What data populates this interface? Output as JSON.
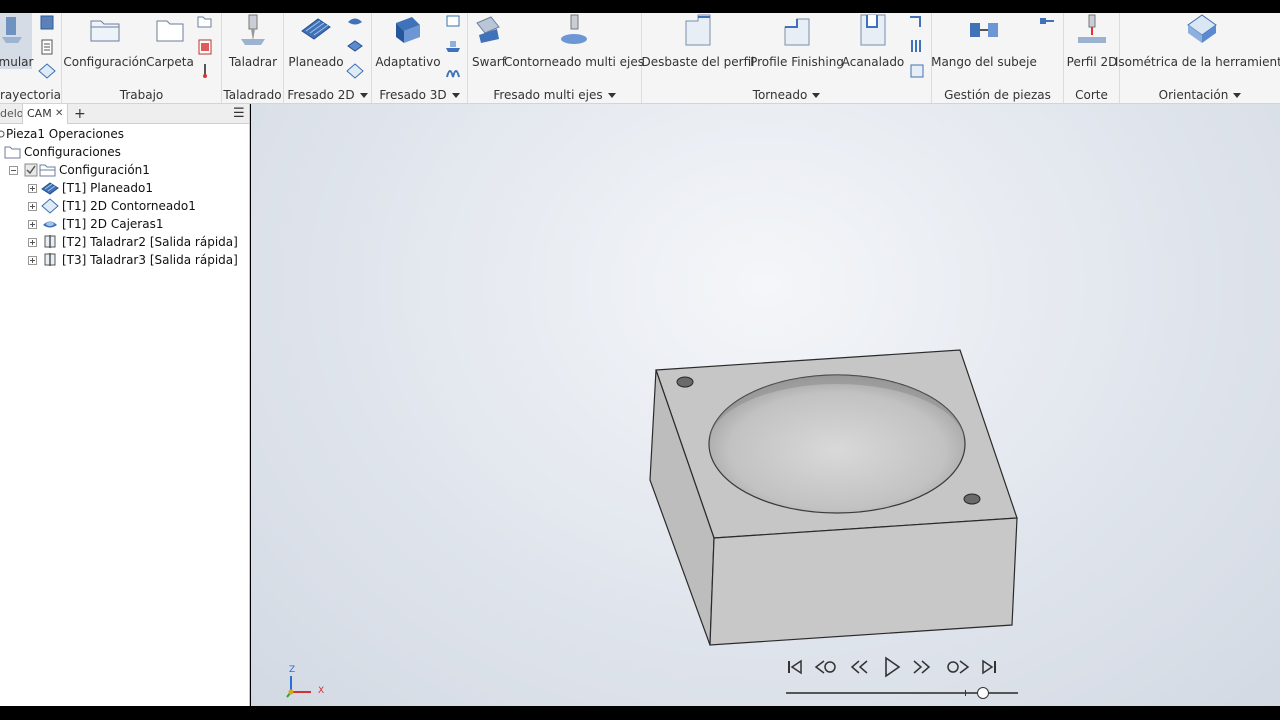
{
  "ribbon": {
    "simulate": {
      "label": "mular",
      "group": "rayectoria"
    },
    "trabajo": {
      "group": "Trabajo",
      "config_label": "Configuración",
      "folder_label": "Carpeta"
    },
    "taladrado": {
      "group": "Taladrado",
      "drill_label": "Taladrar"
    },
    "fresado2d": {
      "group": "Fresado 2D",
      "face_label": "Planeado"
    },
    "fresado3d": {
      "group": "Fresado 3D",
      "adaptive_label": "Adaptativo"
    },
    "multiejes": {
      "group": "Fresado multi ejes",
      "swarf_label": "Swarf",
      "contour_label": "Contorneado multi ejes"
    },
    "torneado": {
      "group": "Torneado",
      "rough_label": "Desbaste del perfil",
      "finish_label": "Profile Finishing",
      "groove_label": "Acanalado"
    },
    "piezas": {
      "group": "Gestión de piezas",
      "sub_label": "Mango del subeje"
    },
    "corte": {
      "group": "Corte",
      "profile_label": "Perfil 2D"
    },
    "orientacion": {
      "group": "Orientación",
      "iso_label": "Isométrica de la herramienta"
    }
  },
  "panel": {
    "tabs": {
      "model": "delo",
      "cam": "CAM",
      "close": "✕",
      "add": "+",
      "menu": "☰"
    },
    "tree": {
      "root": "Pieza1 Operaciones",
      "setups": "Configuraciones",
      "setup1": "Configuración1",
      "ops": [
        {
          "label": "[T1] Planeado1"
        },
        {
          "label": "[T1] 2D Contorneado1"
        },
        {
          "label": "[T1] 2D Cajeras1"
        },
        {
          "label": "[T2] Taladrar2 [Salida rápida]"
        },
        {
          "label": "[T3] Taladrar3 [Salida rápida]"
        }
      ]
    }
  },
  "viewport": {
    "axes": {
      "z": "Z",
      "x": "X"
    },
    "playback": {
      "position": 0.77
    }
  }
}
